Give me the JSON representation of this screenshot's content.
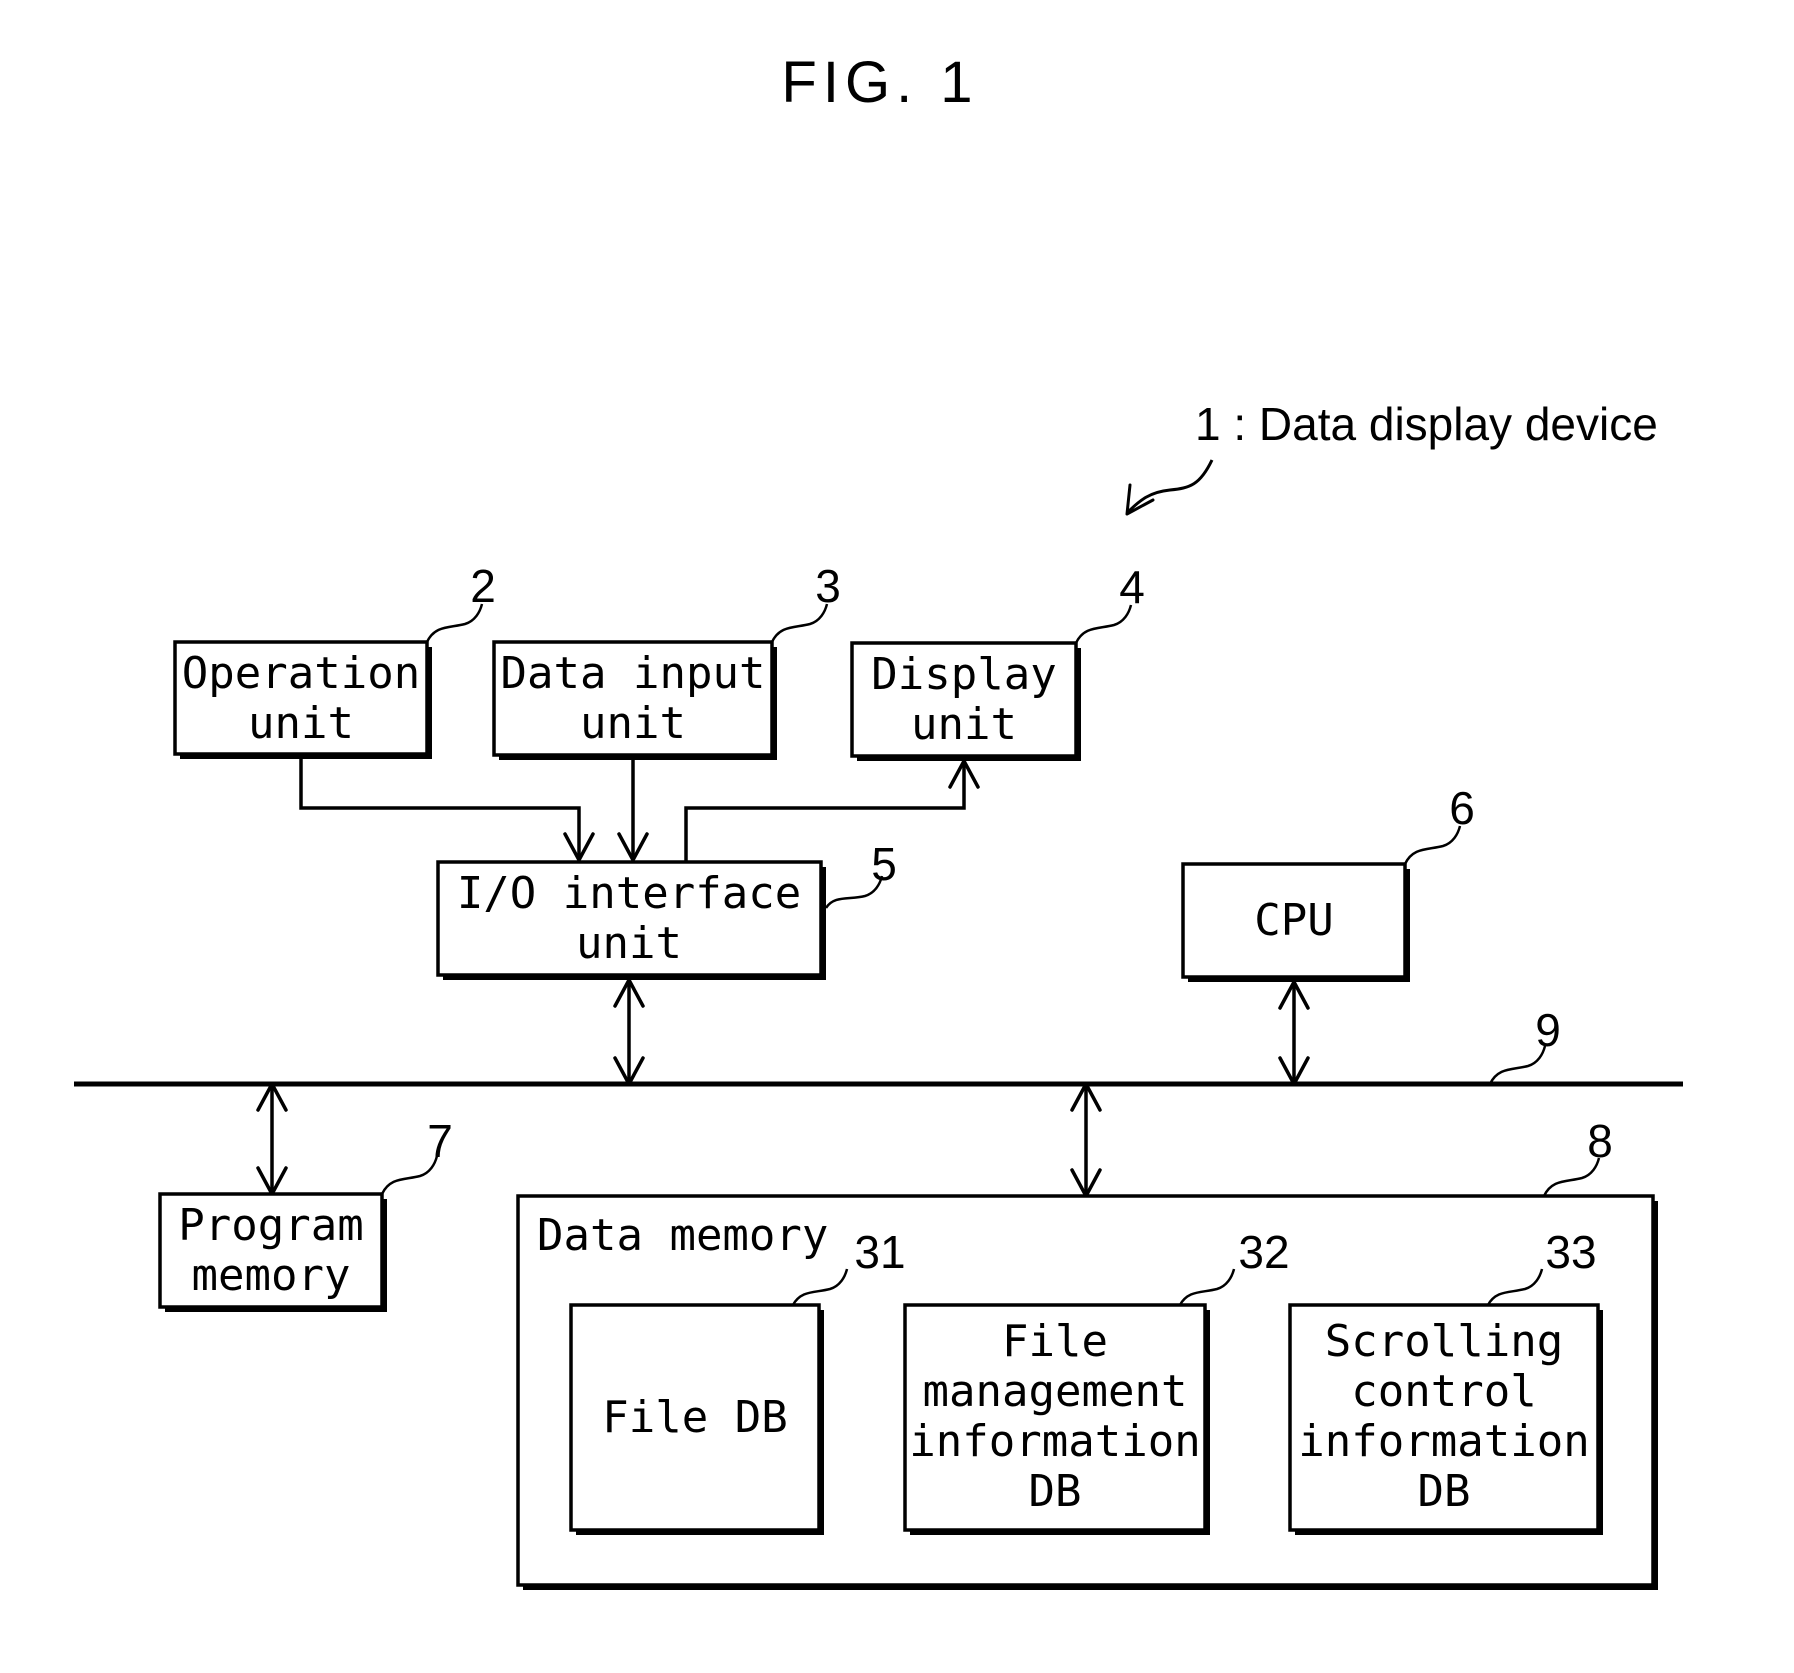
{
  "figure": {
    "title": "FIG. 1",
    "device_label": "1 : Data display device"
  },
  "components": {
    "operation_unit": {
      "ref": "2",
      "lines": [
        "Operation",
        "unit"
      ]
    },
    "data_input_unit": {
      "ref": "3",
      "lines": [
        "Data input",
        "unit"
      ]
    },
    "display_unit": {
      "ref": "4",
      "lines": [
        "Display",
        "unit"
      ]
    },
    "io_interface_unit": {
      "ref": "5",
      "lines": [
        "I/O interface",
        "unit"
      ]
    },
    "cpu": {
      "ref": "6",
      "lines": [
        "CPU"
      ]
    },
    "program_memory": {
      "ref": "7",
      "lines": [
        "Program",
        "memory"
      ]
    },
    "data_memory": {
      "ref": "8",
      "title": "Data memory"
    },
    "bus": {
      "ref": "9"
    },
    "file_db": {
      "ref": "31",
      "lines": [
        "File DB"
      ]
    },
    "file_management_db": {
      "ref": "32",
      "lines": [
        "File",
        "management",
        "information",
        "DB"
      ]
    },
    "scrolling_control_db": {
      "ref": "33",
      "lines": [
        "Scrolling",
        "control",
        "information",
        "DB"
      ]
    }
  },
  "connections": [
    {
      "from": "operation_unit",
      "to": "io_interface_unit",
      "direction": "one-way"
    },
    {
      "from": "data_input_unit",
      "to": "io_interface_unit",
      "direction": "one-way"
    },
    {
      "from": "io_interface_unit",
      "to": "display_unit",
      "direction": "one-way"
    },
    {
      "from": "io_interface_unit",
      "to": "bus",
      "direction": "two-way"
    },
    {
      "from": "cpu",
      "to": "bus",
      "direction": "two-way"
    },
    {
      "from": "program_memory",
      "to": "bus",
      "direction": "two-way"
    },
    {
      "from": "data_memory",
      "to": "bus",
      "direction": "two-way"
    }
  ]
}
